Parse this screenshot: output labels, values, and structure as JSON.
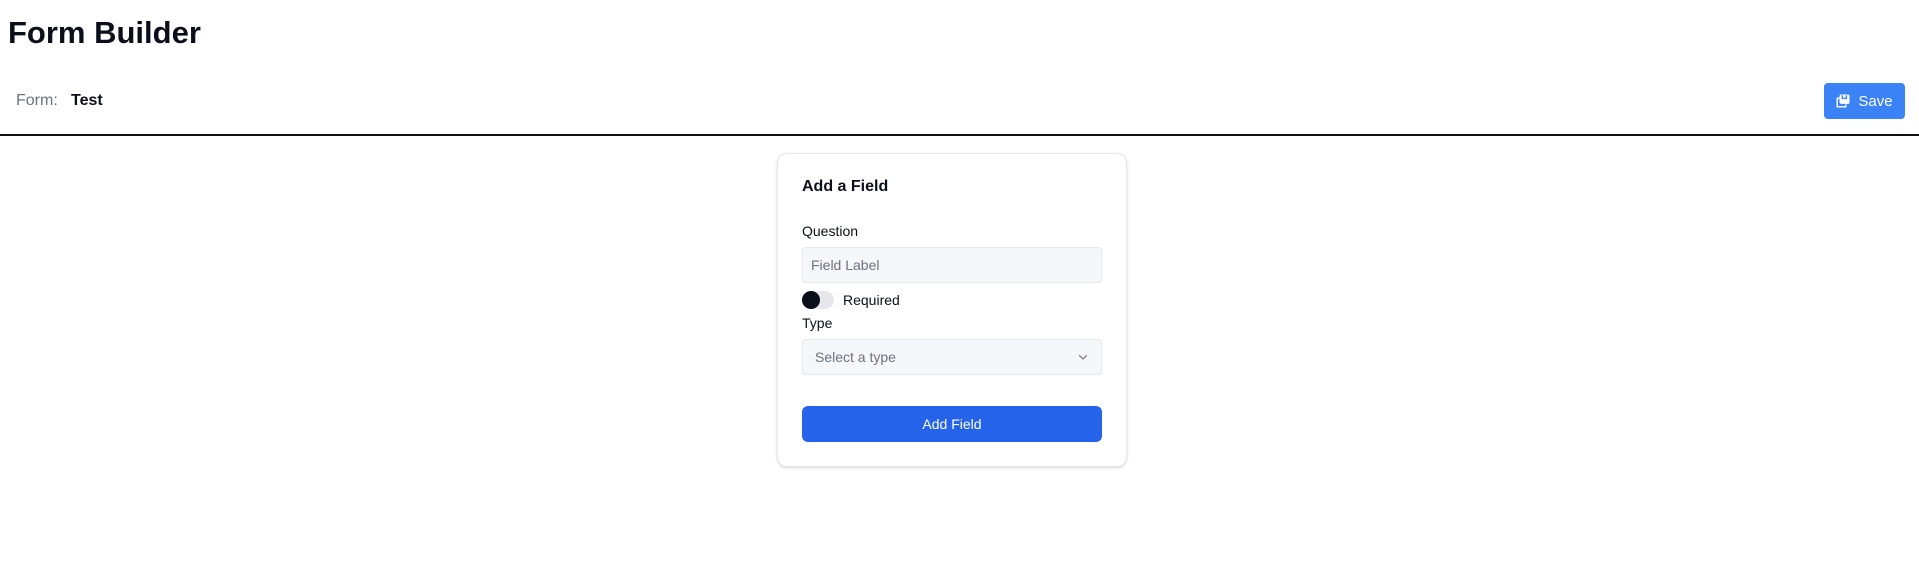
{
  "header": {
    "title": "Form Builder"
  },
  "toolbar": {
    "form_label": "Form:",
    "form_name": "Test",
    "save_label": "Save",
    "save_icon": "save-icon",
    "accent_color": "#3b82f6"
  },
  "add_field_card": {
    "title": "Add a Field",
    "question_label": "Question",
    "question_value": "",
    "question_placeholder": "Field Label",
    "required_label": "Required",
    "required_on": false,
    "type_label": "Type",
    "type_placeholder": "Select a type",
    "type_icon": "chevron-down-icon",
    "submit_label": "Add Field",
    "submit_color": "#2563eb"
  }
}
